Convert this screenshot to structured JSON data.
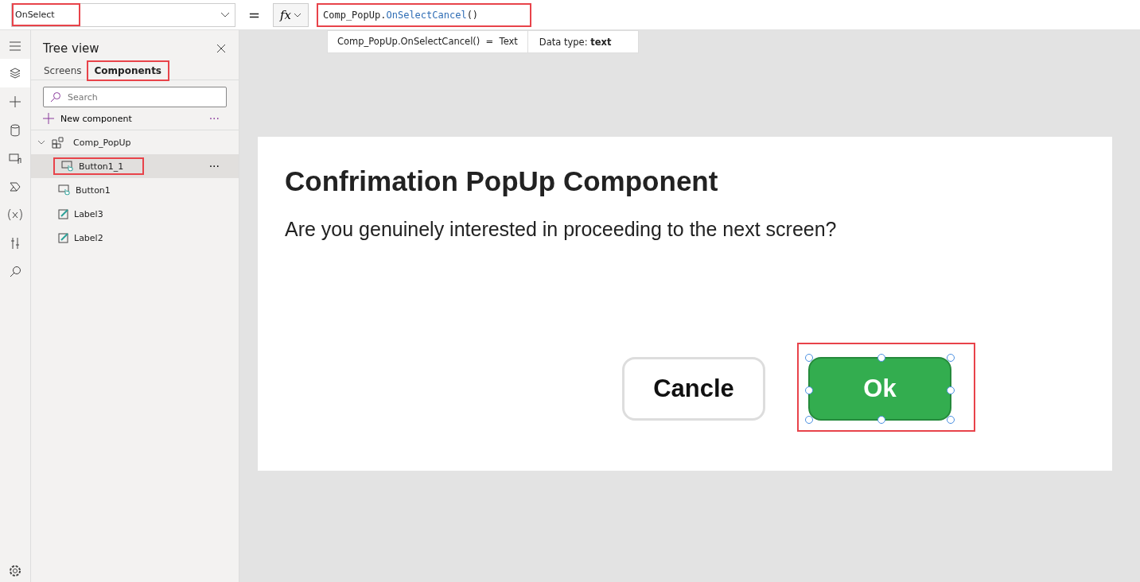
{
  "formula_bar": {
    "property": {
      "value": "OnSelect",
      "highlighted": true
    },
    "equals": "=",
    "fx": "fx",
    "formula": {
      "highlighted": true,
      "tokens": [
        {
          "text": "Comp_PopUp.",
          "kind": "plain"
        },
        {
          "text": "OnSelectCancel",
          "kind": "member"
        },
        {
          "text": "()",
          "kind": "plain"
        }
      ]
    },
    "hint": {
      "expression": "Comp_PopUp.OnSelectCancel()  =  Text",
      "data_type": "Data type: **text**"
    }
  },
  "tree_view": {
    "title": "Tree view",
    "tabs": [
      {
        "label": "Screens",
        "selected": false,
        "highlighted": false
      },
      {
        "label": "Components",
        "selected": true,
        "highlighted": true
      }
    ],
    "search": {
      "placeholder": "Search"
    },
    "new_component": "New component",
    "more": "···",
    "items": [
      {
        "label": "Comp_PopUp",
        "kind": "component",
        "expanded": true,
        "selected": false,
        "highlighted": false,
        "children": [
          {
            "label": "Button1_1",
            "kind": "button",
            "selected": true,
            "highlighted": true,
            "more": "···"
          },
          {
            "label": "Button1",
            "kind": "button",
            "selected": false,
            "highlighted": false
          },
          {
            "label": "Label3",
            "kind": "label",
            "selected": false,
            "highlighted": false
          },
          {
            "label": "Label2",
            "kind": "label",
            "selected": false,
            "highlighted": false
          }
        ]
      }
    ]
  },
  "popup": {
    "title": "Confrimation PopUp Component",
    "message": "Are you genuinely interested in proceeding to the next screen?",
    "buttons": [
      {
        "label": "Cancle",
        "kind": "secondary",
        "selected": false,
        "highlighted": false
      },
      {
        "label": "Ok",
        "kind": "primary",
        "selected": true,
        "highlighted": true
      }
    ]
  }
}
